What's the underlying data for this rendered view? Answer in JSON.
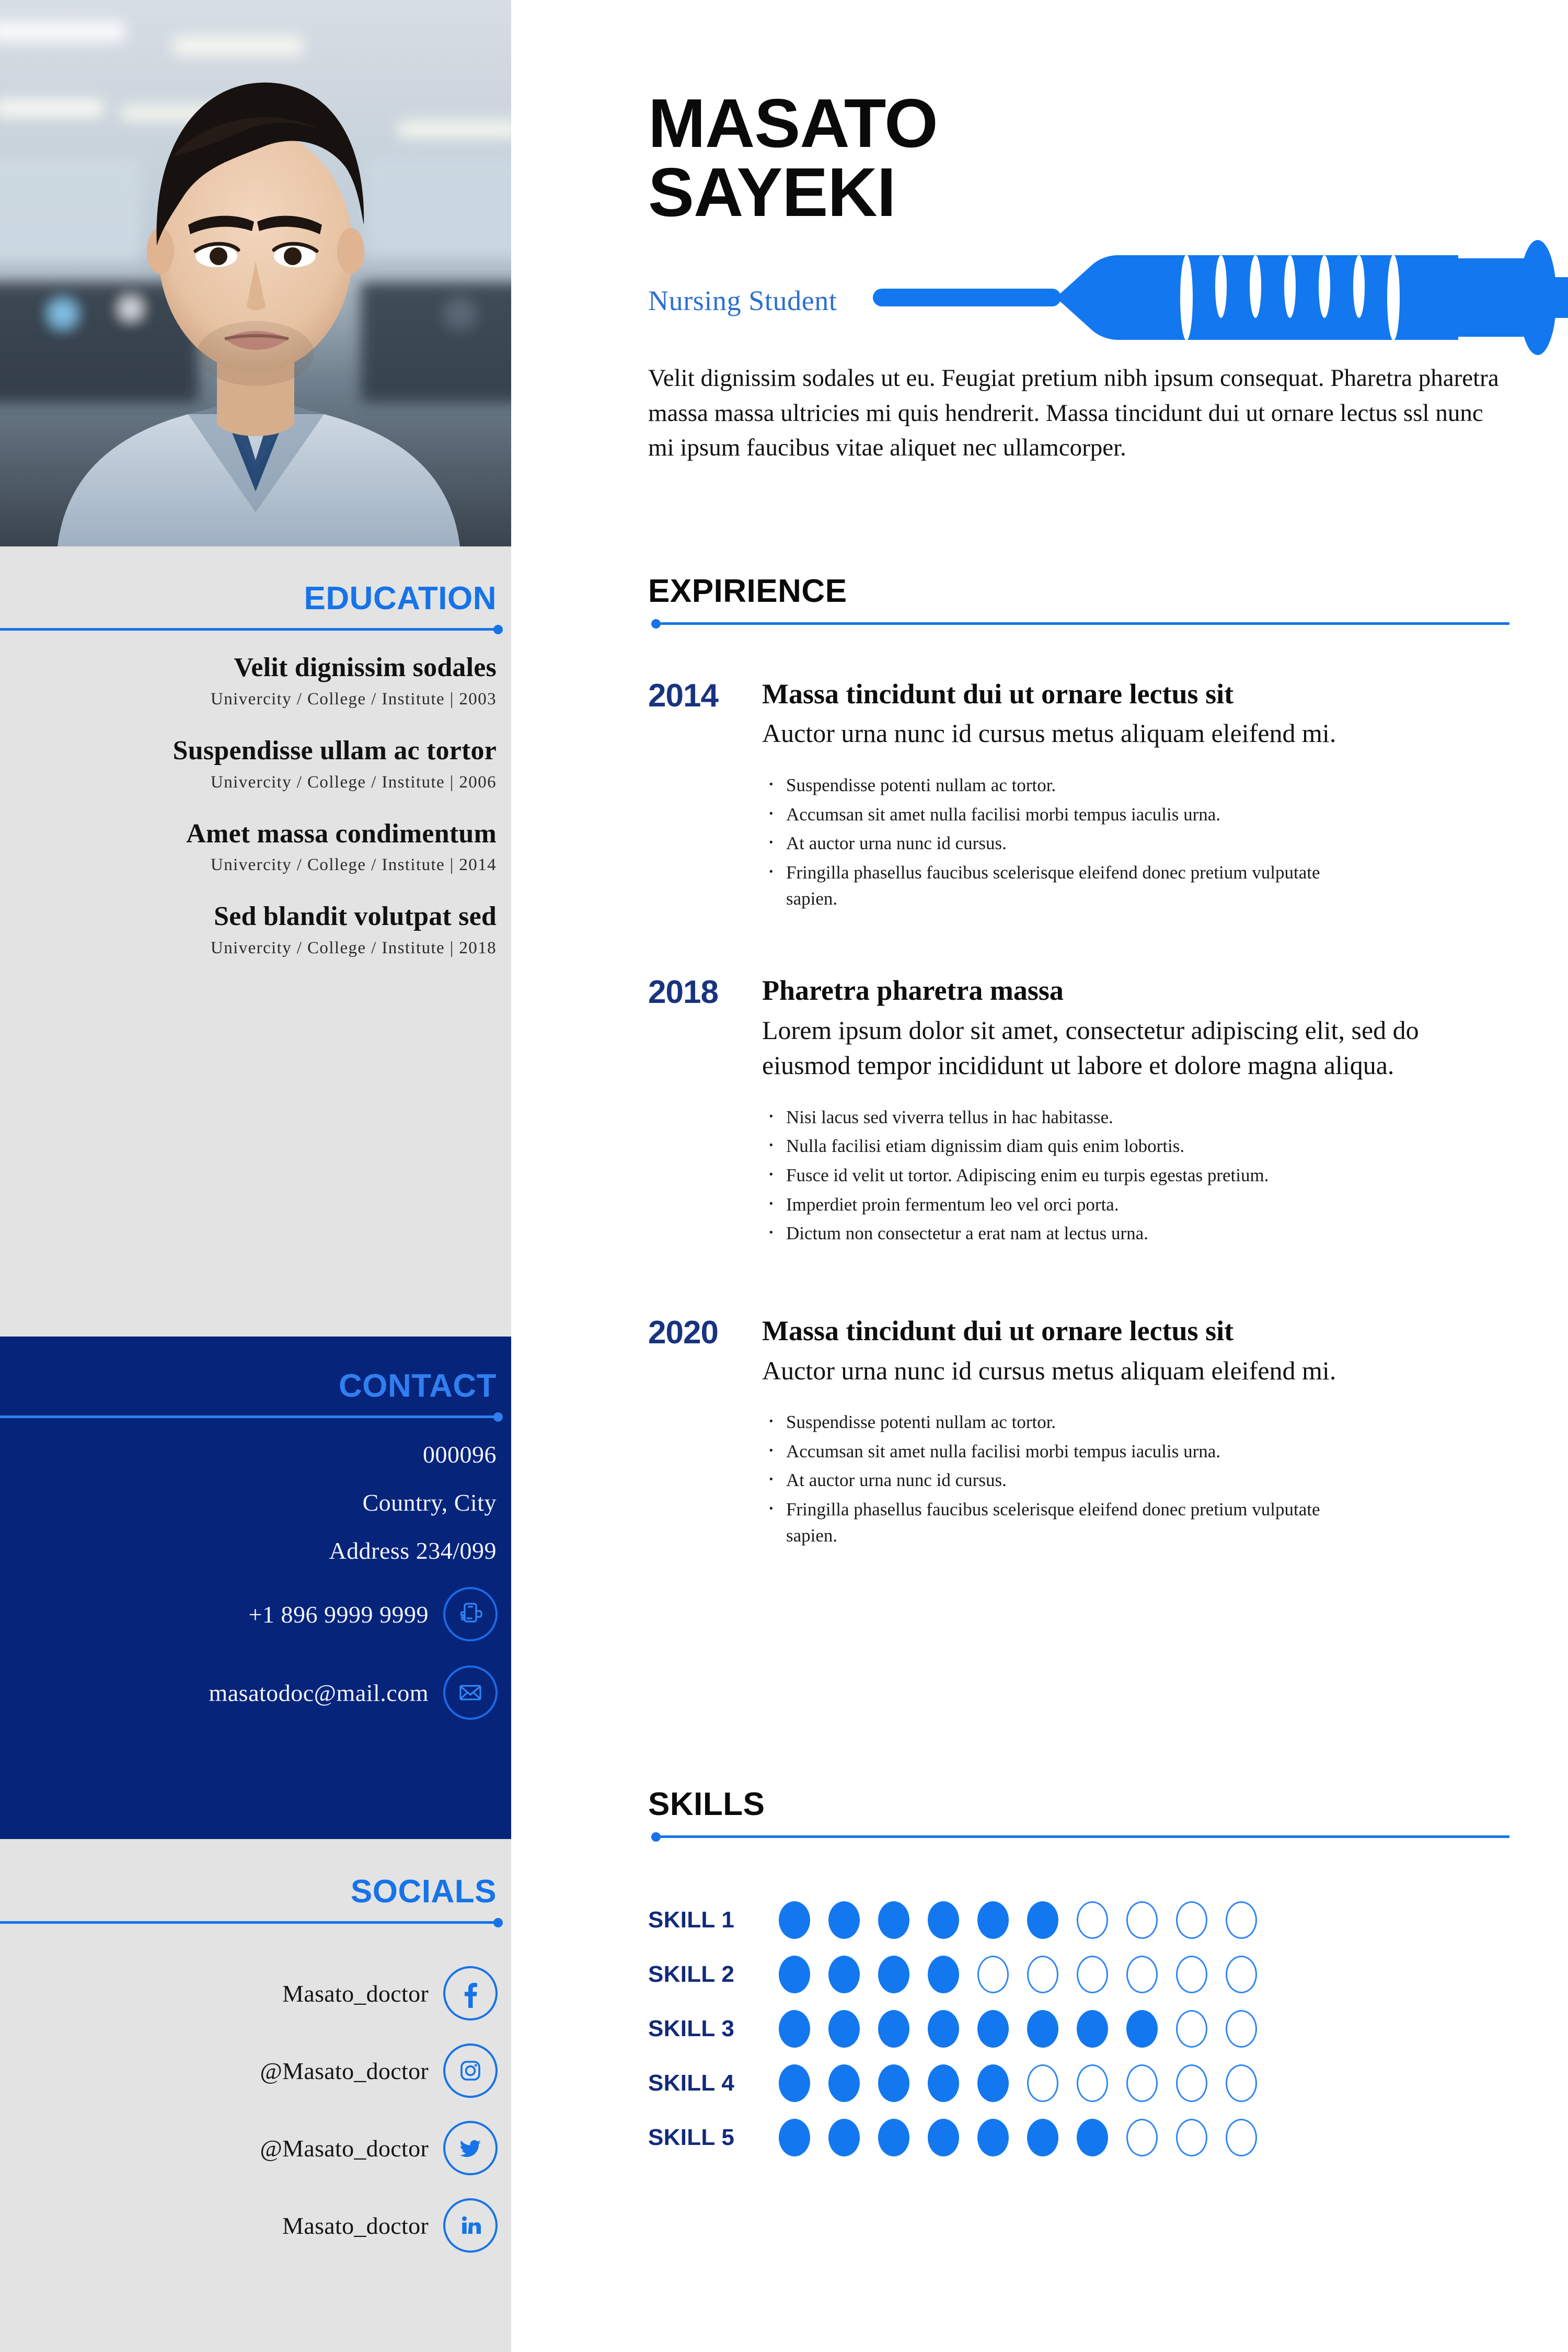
{
  "colors": {
    "accent_blue": "#1673e8",
    "bright_blue": "#1378ef",
    "navy": "#06247a",
    "dark_navy_text": "#18337f",
    "sidebar_gray": "#e3e3e3",
    "role_blue": "#2d6fd0"
  },
  "header": {
    "first_name": "MASATO",
    "last_name": "SAYEKI",
    "role": "Nursing Student",
    "decor_icon": "syringe-icon",
    "summary": "Velit dignissim sodales ut eu. Feugiat pretium nibh ipsum consequat. Pharetra pharetra massa massa ultricies mi quis hendrerit. Massa tincidunt dui ut ornare lectus ssl nunc mi ipsum faucibus vitae aliquet nec ullamcorper."
  },
  "photo": {
    "alt": "profile-photo"
  },
  "education": {
    "title": "EDUCATION",
    "items": [
      {
        "degree": "Velit dignissim sodales",
        "institute": "Univercity / College / Institute | 2003"
      },
      {
        "degree": "Suspendisse ullam ac tortor",
        "institute": "Univercity / College / Institute | 2006"
      },
      {
        "degree": "Amet massa condimentum",
        "institute": "Univercity / College / Institute | 2014"
      },
      {
        "degree": "Sed blandit volutpat sed",
        "institute": "Univercity / College / Institute | 2018"
      }
    ]
  },
  "contact": {
    "title": "CONTACT",
    "postal_code": "000096",
    "location": "Country, City",
    "address": "Address 234/099",
    "phone": "+1 896 9999 9999",
    "phone_icon": "phone-in-hand-icon",
    "email": "masatodoc@mail.com",
    "email_icon": "envelope-icon"
  },
  "socials": {
    "title": "SOCIALS",
    "items": [
      {
        "handle": "Masato_doctor",
        "icon": "facebook-icon"
      },
      {
        "handle": "@Masato_doctor",
        "icon": "instagram-icon"
      },
      {
        "handle": "@Masato_doctor",
        "icon": "twitter-icon"
      },
      {
        "handle": "Masato_doctor",
        "icon": "linkedin-icon"
      }
    ]
  },
  "experience": {
    "title": "EXPIRIENCE",
    "items": [
      {
        "year": "2014",
        "title": "Massa tincidunt dui ut ornare lectus sit",
        "description": "Auctor urna nunc id cursus metus aliquam eleifend mi.",
        "bullets": [
          "Suspendisse potenti nullam ac tortor.",
          "Accumsan sit amet nulla facilisi morbi tempus iaculis urna.",
          "At auctor urna nunc id cursus.",
          "Fringilla phasellus faucibus scelerisque eleifend donec pretium vulputate sapien."
        ]
      },
      {
        "year": "2018",
        "title": "Pharetra pharetra massa",
        "description": "Lorem ipsum dolor sit amet, consectetur adipiscing elit, sed do eiusmod tempor incididunt ut labore et dolore magna aliqua.",
        "bullets": [
          "Nisi lacus sed viverra tellus in hac habitasse.",
          "Nulla facilisi etiam dignissim diam quis enim lobortis.",
          "Fusce id velit ut tortor. Adipiscing enim eu turpis egestas pretium.",
          "Imperdiet proin fermentum leo vel orci porta.",
          "Dictum non consectetur a erat nam at lectus urna."
        ]
      },
      {
        "year": "2020",
        "title": "Massa tincidunt dui ut ornare lectus sit",
        "description": "Auctor urna nunc id cursus metus aliquam eleifend mi.",
        "bullets": [
          "Suspendisse potenti nullam ac tortor.",
          "Accumsan sit amet nulla facilisi morbi tempus iaculis urna.",
          "At auctor urna nunc id cursus.",
          "Fringilla phasellus faucibus scelerisque eleifend donec pretium vulputate sapien."
        ]
      }
    ]
  },
  "skills": {
    "title": "SKILLS",
    "max": 10,
    "items": [
      {
        "label": "SKILL 1",
        "value": 6
      },
      {
        "label": "SKILL 2",
        "value": 4
      },
      {
        "label": "SKILL 3",
        "value": 8
      },
      {
        "label": "SKILL 4",
        "value": 5
      },
      {
        "label": "SKILL 5",
        "value": 7
      }
    ]
  }
}
